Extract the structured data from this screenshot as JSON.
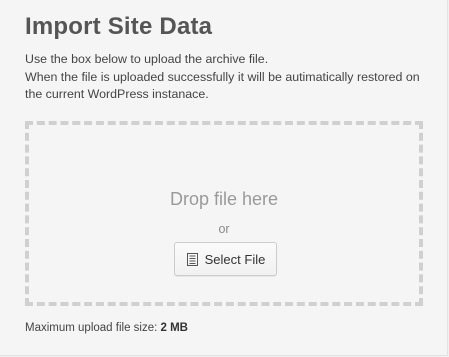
{
  "page": {
    "title": "Import Site Data",
    "description_line1": "Use the box below to upload the archive file.",
    "description_line2": "When the file is uploaded successfully it will be autimatically restored on",
    "description_line3": "the current WordPress instanace."
  },
  "dropzone": {
    "drop_text": "Drop file here",
    "or_text": "or",
    "select_button_label": "Select File",
    "select_button_icon": "file-icon"
  },
  "footer": {
    "max_size_label": "Maximum upload file size:",
    "max_size_value": "2 MB"
  }
}
